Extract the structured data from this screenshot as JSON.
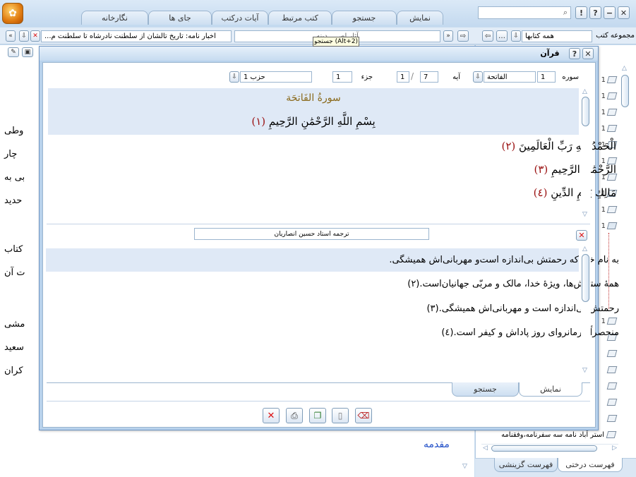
{
  "top_tabs": [
    "نمایش",
    "جستجو",
    "کتب مرتبط",
    "آیات درکتب",
    "جای ها",
    "نگارخانه"
  ],
  "window_controls": {
    "close": "✕",
    "minimize": "−",
    "help": "?",
    "info": "!"
  },
  "search_value": "",
  "nav": {
    "collection_label": "مجموعه کتب",
    "collection_value": "همه کتابها",
    "location_value": "آثار اصـ...ـدینه",
    "book_title": "اخبار نامه: تاریخ تالشان از سلطنت نادرشاه تا سلطنت م..."
  },
  "tooltip": "جستجو (Alt+2)",
  "background_text_fragments": [
    "وطی",
    "چار",
    "بی به",
    "حدید",
    "کتاب",
    "ت آن",
    "مشی",
    "سعید",
    "کران"
  ],
  "background_link": "مقدمه",
  "dialog": {
    "title": "قرآن",
    "fields": {
      "sura_label": "سوره",
      "sura_number": "1",
      "sura_name": "الفاتحة",
      "aya_label": "آیه",
      "aya_value": "1",
      "aya_total": "7",
      "juz_label": "جزء",
      "juz_value": "1",
      "hizb_value": "حزب 1"
    },
    "sura_heading": "سورةُ الفَاتحَة",
    "basmala": "بِسْمِ اللَّهِ الرَّحْمَٰنِ الرَّحِيمِ",
    "basmala_num": "(١)",
    "verses": [
      {
        "text": "الْحَمْدُ لِلَّهِ رَبِّ الْعَالَمِينَ",
        "num": "(٢)"
      },
      {
        "text": "الرَّحْمَٰنِ الرَّحِيمِ",
        "num": "(٣)"
      },
      {
        "text": "مَالِكِ يَوْمِ الدِّينِ",
        "num": "(٤)"
      }
    ],
    "translator": "ترجمه استاد حسین انصاریان",
    "translations": [
      "به نام خدا که رحمتش بی‌اندازه است‌و مهربانی‌اش همیشگی.",
      "همهٔ ستایش‌ها، ویژهٔ خدا، مالک و مربّی جهانیان‌است.(۲)",
      "رحمتش بی‌اندازه است و مهربانی‌اش همیشگی.(۳)",
      "منحصراً فرمانروای روز پاداش و کیفر است.(٤)"
    ],
    "bottom_tabs": [
      "نمایش",
      "جستجو"
    ]
  },
  "tree": {
    "numbers": [
      "1",
      "1",
      "1",
      "1",
      "1",
      "1",
      "1",
      "1",
      "1",
      "1",
      "1"
    ],
    "last_item": "استر آباد نامه سه سفرنامه،وفقنامه",
    "bottom_tabs": [
      "فهرست درختی",
      "فهرست گزینشی"
    ]
  }
}
